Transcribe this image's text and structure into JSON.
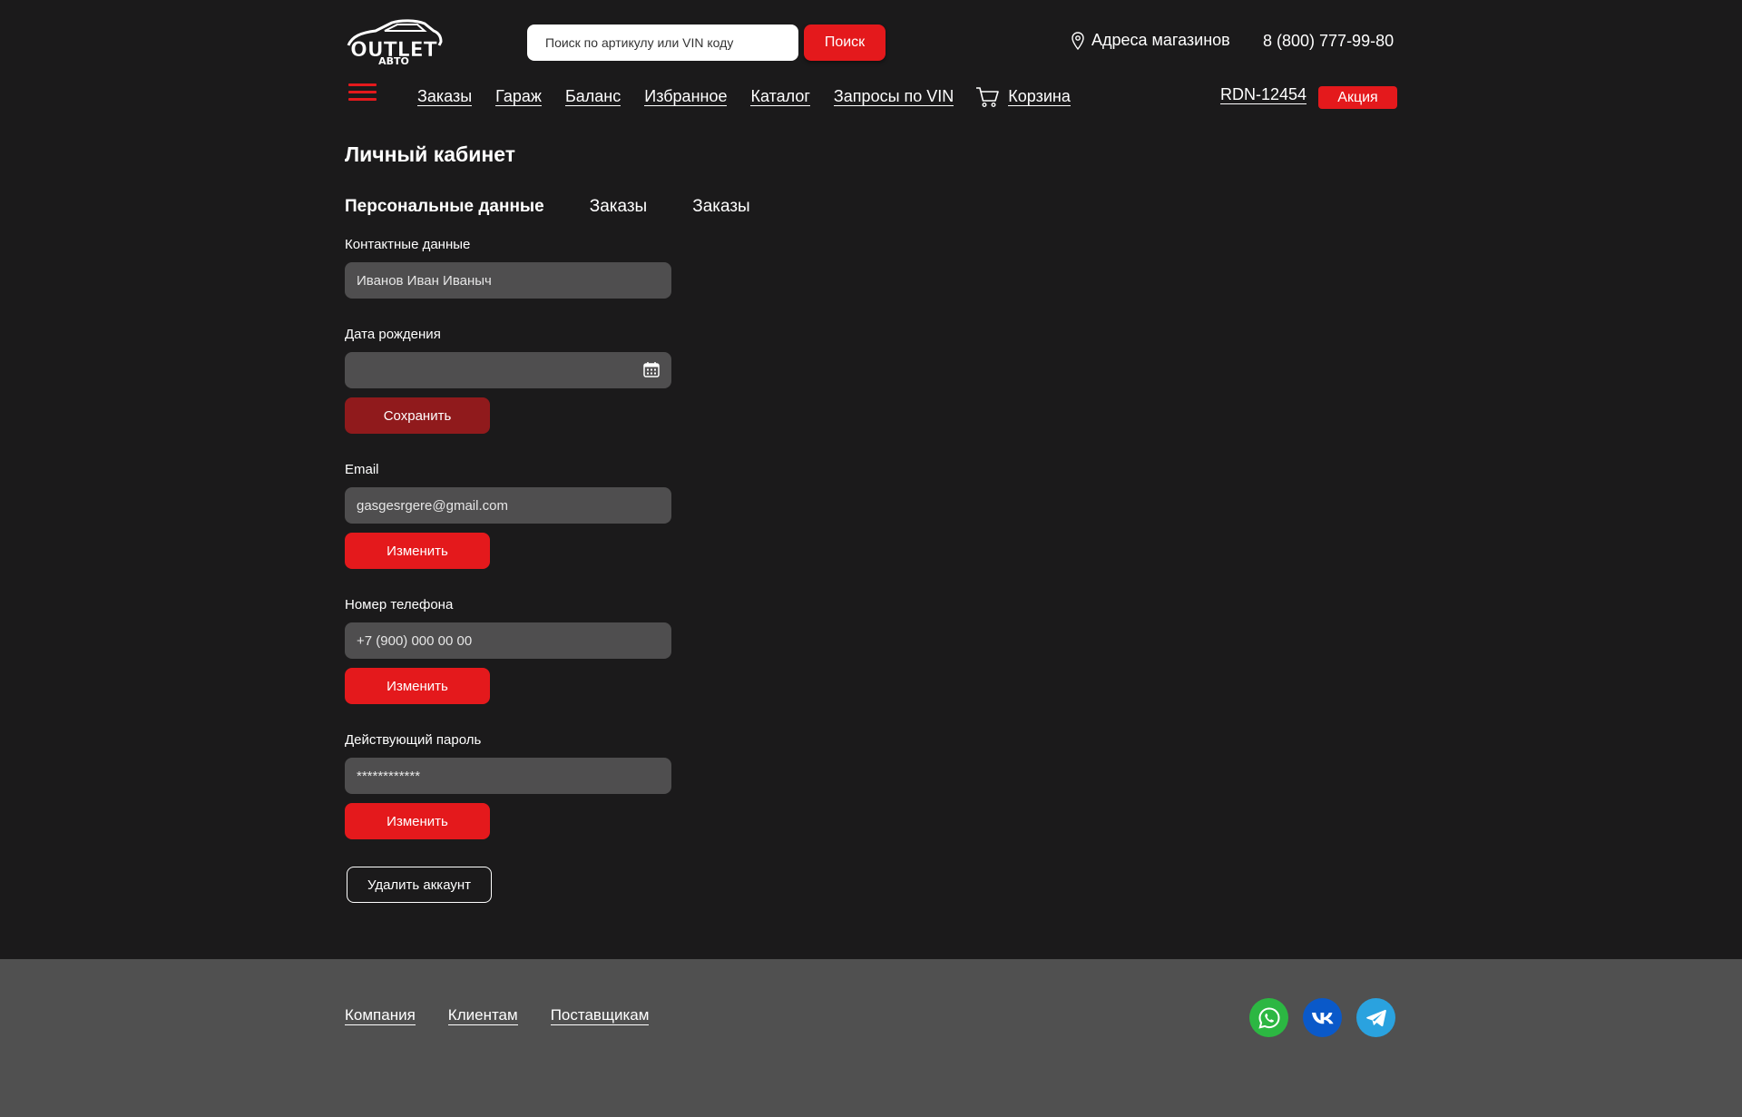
{
  "header": {
    "logo": {
      "line1": "OUTLET",
      "line2": "АВТО"
    },
    "search": {
      "placeholder": "Поиск по артикулу или VIN коду",
      "button_label": "Поиск"
    },
    "stores_label": "Адреса магазинов",
    "phone": "8 (800) 777-99-80",
    "user_id": "RDN-12454",
    "promo_label": "Акция"
  },
  "nav": {
    "items": [
      "Заказы",
      "Гараж",
      "Баланс",
      "Избранное",
      "Каталог",
      "Запросы по VIN"
    ],
    "cart_label": "Корзина"
  },
  "page": {
    "title": "Личный кабинет",
    "tabs": [
      {
        "label": "Персональные данные",
        "active": true
      },
      {
        "label": "Заказы",
        "active": false
      },
      {
        "label": "Заказы",
        "active": false
      }
    ]
  },
  "form": {
    "contact": {
      "label": "Контактные данные",
      "value": "Иванов Иван Иваныч"
    },
    "birthdate": {
      "label": "Дата рождения",
      "value": ""
    },
    "save_label": "Сохранить",
    "email": {
      "label": "Email",
      "value": "gasgesrgere@gmail.com",
      "button_label": "Изменить"
    },
    "phone": {
      "label": "Номер телефона",
      "value": "+7 (900) 000 00 00",
      "button_label": "Изменить"
    },
    "password": {
      "label": "Действующий пароль",
      "value": "************",
      "button_label": "Изменить"
    },
    "delete_label": "Удалить аккаунт"
  },
  "footer": {
    "links": [
      "Компания",
      "Клиентам",
      "Поставщикам"
    ],
    "social": [
      {
        "icon": "whatsapp-icon",
        "color": "#2cb742"
      },
      {
        "icon": "vk-icon",
        "color": "#0a59c9"
      },
      {
        "icon": "telegram-icon",
        "color": "#2aa2df"
      }
    ]
  },
  "colors": {
    "background": "#1b1a1b",
    "accent": "#e4191c",
    "save_button": "#901a1c",
    "field": "#4f4e4f",
    "footer": "#505050"
  }
}
